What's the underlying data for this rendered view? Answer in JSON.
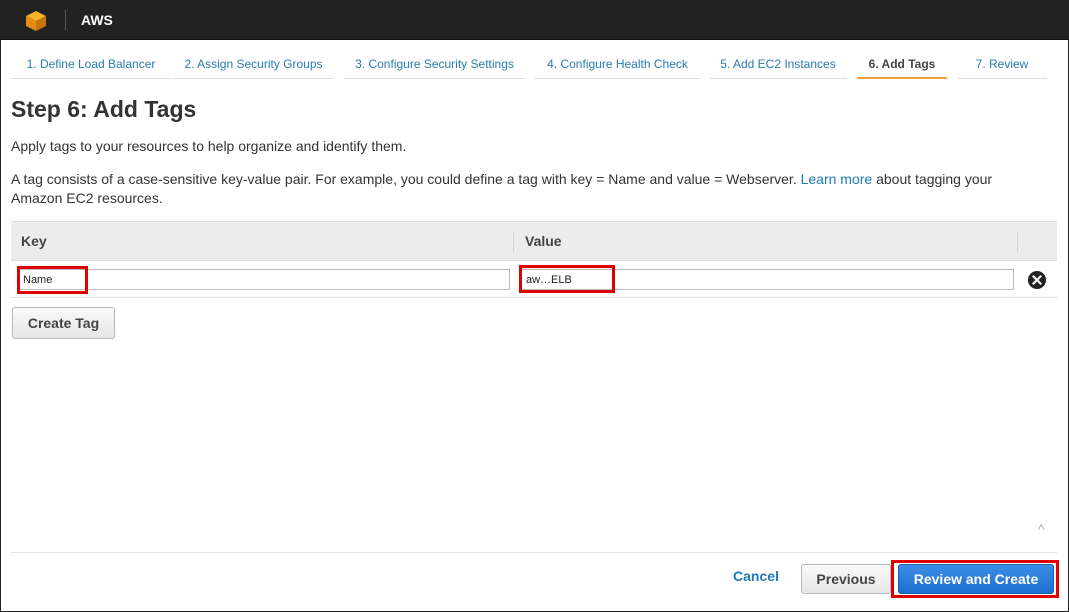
{
  "header": {
    "brand": "AWS"
  },
  "wizard": {
    "steps": [
      {
        "label": "1. Define Load Balancer"
      },
      {
        "label": "2. Assign Security Groups"
      },
      {
        "label": "3. Configure Security Settings"
      },
      {
        "label": "4. Configure Health Check"
      },
      {
        "label": "5. Add EC2 Instances"
      },
      {
        "label": "6. Add Tags"
      },
      {
        "label": "7. Review"
      }
    ],
    "active_step": 6
  },
  "page": {
    "title": "Step 6: Add Tags",
    "description": "Apply tags to your resources to help organize and identify them.",
    "detail_before_link": "A tag consists of a case-sensitive key-value pair. For example, you could define a tag with key = Name and value = Webserver.",
    "learn_more_label": "Learn more",
    "detail_after_link": "about tagging your Amazon EC2 resources."
  },
  "table": {
    "columns": [
      "Key",
      "Value"
    ],
    "rows": [
      {
        "key": "Name",
        "value": "aw…ELB"
      }
    ]
  },
  "buttons": {
    "create_tag": "Create Tag",
    "cancel": "Cancel",
    "previous": "Previous",
    "review_and_create": "Review and Create"
  },
  "colors": {
    "topbar": "#222222",
    "link": "#1f7ab8",
    "active_step_underline": "#e8a33d",
    "highlight": "#e00000",
    "primary_button": "#1f6fcf"
  }
}
